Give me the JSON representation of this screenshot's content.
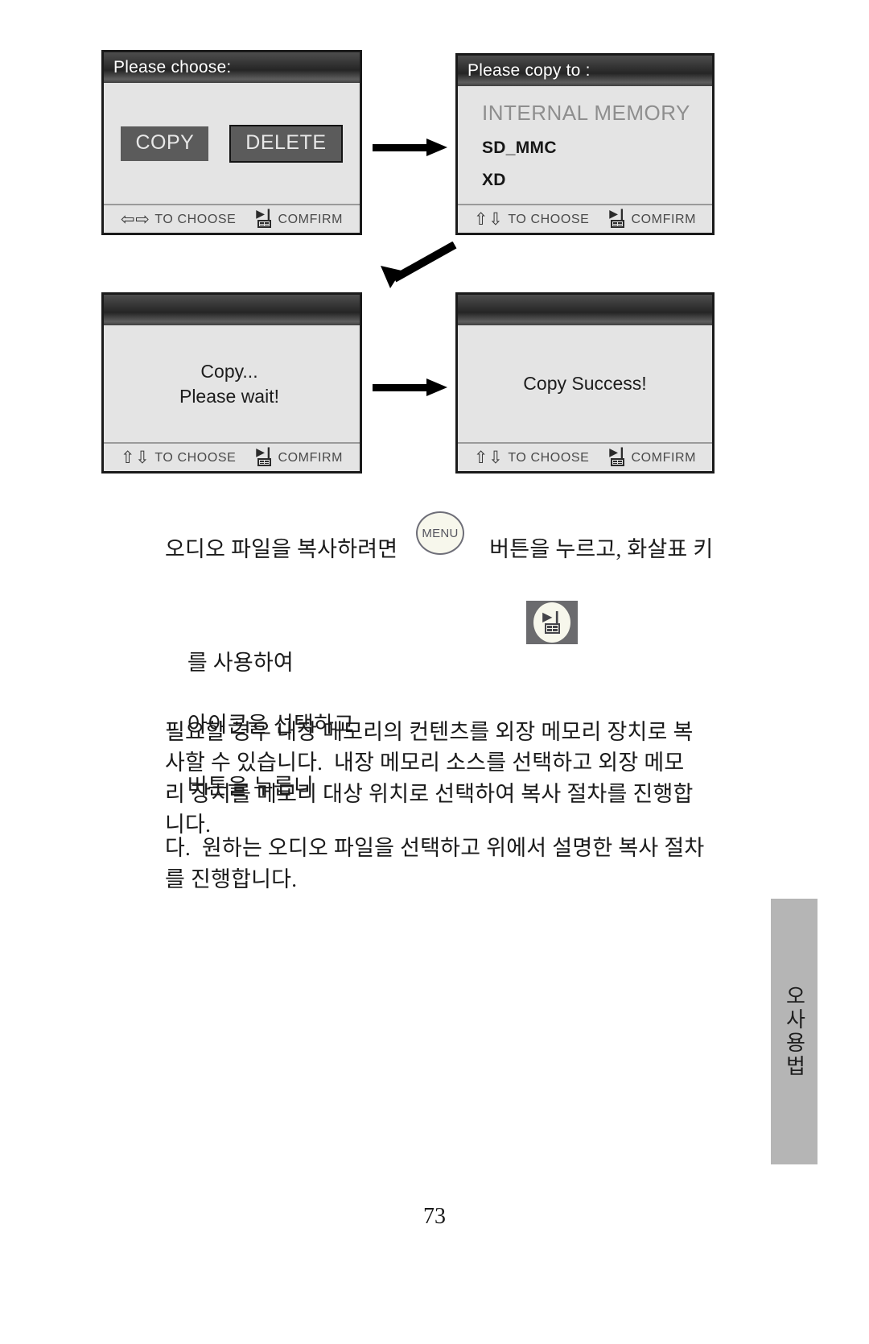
{
  "panels": [
    {
      "id": "choose",
      "title": "Please choose:",
      "buttons": [
        {
          "label": "COPY",
          "style": "flat"
        },
        {
          "label": "DELETE",
          "style": "bordered"
        }
      ],
      "status": {
        "arrows": "⇦⇨",
        "arrow_kind": "left-right",
        "choose_label": "TO CHOOSE",
        "confirm_label": "COMFIRM",
        "confirm_icon_top": "▶❙"
      }
    },
    {
      "id": "copy-to",
      "title": "Please copy to :",
      "items": [
        {
          "label": "INTERNAL MEMORY",
          "emphasis": "dim"
        },
        {
          "label": "SD_MMC",
          "emphasis": "strong"
        },
        {
          "label": "XD",
          "emphasis": "strong"
        }
      ],
      "status": {
        "arrows": "⇧⇩",
        "arrow_kind": "up-down",
        "choose_label": "TO CHOOSE",
        "confirm_label": "COMFIRM",
        "confirm_icon_top": "▶❙"
      }
    },
    {
      "id": "copying",
      "title": "",
      "message_line1": "Copy...",
      "message_line2": "Please wait!",
      "status": {
        "arrows": "⇧⇩",
        "arrow_kind": "up-down",
        "choose_label": "TO CHOOSE",
        "confirm_label": "COMFIRM",
        "confirm_icon_top": "▶❙"
      }
    },
    {
      "id": "success",
      "title": "",
      "message_line1": "Copy Success!",
      "message_line2": "",
      "status": {
        "arrows": "⇧⇩",
        "arrow_kind": "up-down",
        "choose_label": "TO CHOOSE",
        "confirm_label": "COMFIRM",
        "confirm_icon_top": "▶❙"
      }
    }
  ],
  "inline_buttons": {
    "menu_label": "MENU",
    "playpause_glyph": "▶❙"
  },
  "body_text": {
    "p1_before_menu": "오디오 파일을 복사하려면",
    "p1_after_menu": "버튼을 누르고, 화살표 키",
    "p2_line1_a": "를 사용하여",
    "p2_line1_b": "아이콘을 선택하고",
    "p2_line1_c": "버튼을 누릅니",
    "p2_line2": "다.  원하는 오디오 파일을 선택하고 위에서 설명한 복사 절차",
    "p2_line3": "를 진행합니다.",
    "p3_line1": "필요할 경우 내장 메모리의 컨텐츠를 외장 메모리 장치로 복",
    "p3_line2": "사할 수 있습니다.  내장 메모리 소스를 선택하고 외장 메모",
    "p3_line3": "리 장치를 메모리 대상 위치로 선택하여 복사 절차를 진행합",
    "p3_line4": "니다."
  },
  "side_tab": {
    "label": "오사용법"
  },
  "page_number": "73"
}
